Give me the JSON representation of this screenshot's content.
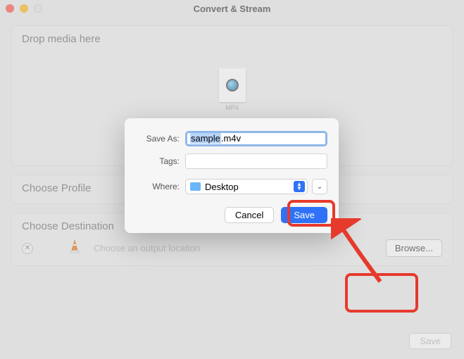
{
  "window": {
    "title": "Convert & Stream"
  },
  "drop": {
    "title": "Drop media here",
    "file_ext": "MP4"
  },
  "profile": {
    "title": "Choose Profile"
  },
  "destination": {
    "title": "Choose Destination",
    "placeholder": "Choose an output location",
    "browse_label": "Browse..."
  },
  "footer": {
    "save_label": "Save"
  },
  "dialog": {
    "save_as_label": "Save As:",
    "filename_selected": "sample",
    "filename_rest": ".m4v",
    "tags_label": "Tags:",
    "where_label": "Where:",
    "where_value": "Desktop",
    "cancel_label": "Cancel",
    "save_label": "Save"
  }
}
